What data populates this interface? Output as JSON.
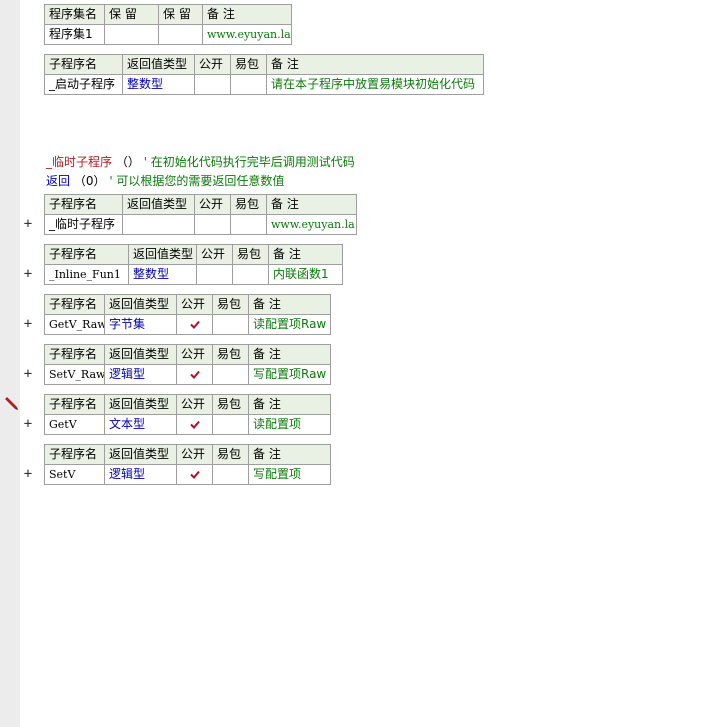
{
  "assembly_table": {
    "headers": [
      "程序集名",
      "保 留",
      "保 留",
      "备 注"
    ],
    "row": [
      "程序集1",
      "",
      "",
      "www.eyuyan.la"
    ]
  },
  "startup_table": {
    "headers": [
      "子程序名",
      "返回值类型",
      "公开",
      "易包",
      "备 注"
    ],
    "row": {
      "name": "_启动子程序",
      "type": "整数型",
      "public": "",
      "epkg": "",
      "note": "请在本子程序中放置易模块初始化代码"
    }
  },
  "code": {
    "line1": {
      "name": "_临时子程序",
      "parens": "（）",
      "comment": "' 在初始化代码执行完毕后调用测试代码"
    },
    "line2": {
      "keyword": "返回",
      "arg": "（0）",
      "comment": "' 可以根据您的需要返回任意数值"
    }
  },
  "sub_headers": [
    "子程序名",
    "返回值类型",
    "公开",
    "易包",
    "备 注"
  ],
  "subs": [
    {
      "name": "_临时子程序",
      "type": "",
      "public": false,
      "epkg": "",
      "note": "www.eyuyan.la",
      "expander": "+"
    },
    {
      "name": "_Inline_Fun1",
      "type": "整数型",
      "public": false,
      "epkg": "",
      "note": "内联函数1",
      "expander": "+"
    },
    {
      "name": "GetV_Raw",
      "type": "字节集",
      "public": true,
      "epkg": "",
      "note": "读配置项Raw",
      "expander": "+"
    },
    {
      "name": "SetV_Raw",
      "type": "逻辑型",
      "public": true,
      "epkg": "",
      "note": "写配置项Raw",
      "expander": "+"
    },
    {
      "name": "GetV",
      "type": "文本型",
      "public": true,
      "epkg": "",
      "note": "读配置项",
      "expander": "+"
    },
    {
      "name": "SetV",
      "type": "逻辑型",
      "public": true,
      "epkg": "",
      "note": "写配置项",
      "expander": "+"
    }
  ],
  "colors": {
    "header_bg": "#e9f1e4",
    "type_blue": "#0000b0",
    "note_green": "#0a7a0a",
    "check_red": "#b0102a",
    "gutter": "#ececec"
  }
}
